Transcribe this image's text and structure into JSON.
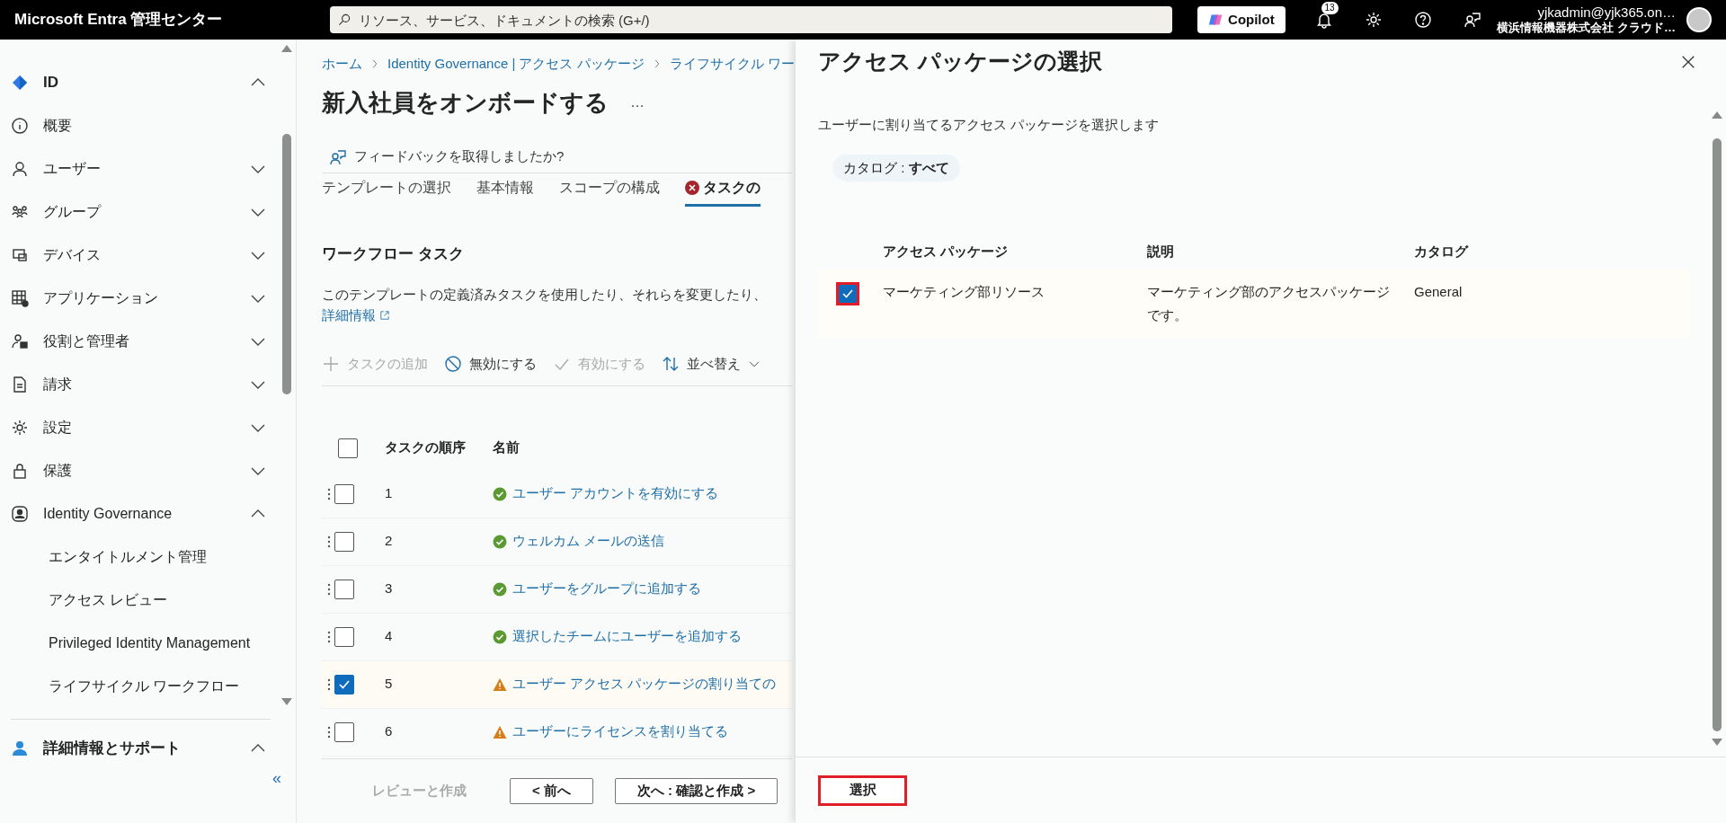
{
  "top_bar": {
    "title": "Microsoft Entra 管理センター",
    "search": {
      "placeholder": "リソース、サービス、ドキュメントの検索 (G+/)"
    },
    "copilot_button": "Copilot",
    "notification_count": "13",
    "user": {
      "account": "yjkadmin@yjk365.on…",
      "organization": "横浜情報機器株式会社 クラウド…"
    }
  },
  "sidebar": {
    "items": [
      {
        "kind": "section",
        "label": "ID",
        "expanded": true
      },
      {
        "kind": "item",
        "label": "概要"
      },
      {
        "kind": "item",
        "label": "ユーザー",
        "expanded": false
      },
      {
        "kind": "item",
        "label": "グループ",
        "expanded": false
      },
      {
        "kind": "item",
        "label": "デバイス",
        "expanded": false
      },
      {
        "kind": "item",
        "label": "アプリケーション",
        "expanded": false
      },
      {
        "kind": "item",
        "label": "役割と管理者",
        "expanded": false
      },
      {
        "kind": "item",
        "label": "請求",
        "expanded": false
      },
      {
        "kind": "item",
        "label": "設定",
        "expanded": false
      },
      {
        "kind": "item",
        "label": "保護",
        "expanded": false
      },
      {
        "kind": "item",
        "label": "Identity Governance",
        "expanded": true
      },
      {
        "kind": "subitem",
        "label": "エンタイトルメント管理"
      },
      {
        "kind": "subitem",
        "label": "アクセス レビュー"
      },
      {
        "kind": "subitem",
        "label": "Privileged Identity Management"
      },
      {
        "kind": "subitem",
        "label": "ライフサイクル ワークフロー"
      }
    ],
    "footer": {
      "label": "詳細情報とサポート",
      "expanded": true
    },
    "collapse_button": "«"
  },
  "main": {
    "breadcrumb": [
      "ホーム",
      "Identity Governance | アクセス パッケージ",
      "ライフサイクル ワー"
    ],
    "title": "新入社員をオンボードする",
    "more_button": "…",
    "feedback": "フィードバックを取得しましたか?",
    "tabs": [
      {
        "label": "テンプレートの選択",
        "selected": false
      },
      {
        "label": "基本情報",
        "selected": false
      },
      {
        "label": "スコープの構成",
        "selected": false
      },
      {
        "label": "タスクの",
        "selected": true,
        "error": true
      }
    ],
    "section_title": "ワークフロー タスク",
    "description": "このテンプレートの定義済みタスクを使用したり、それらを変更したり、",
    "learn_more": "詳細情報",
    "toolbar": [
      {
        "kind": "add",
        "label": "タスクの追加",
        "disabled": true
      },
      {
        "kind": "disable",
        "label": "無効にする",
        "disabled": false
      },
      {
        "kind": "enable",
        "label": "有効にする",
        "disabled": true
      },
      {
        "kind": "sort",
        "label": "並べ替え",
        "disabled": false
      }
    ],
    "table": {
      "columns": [
        "タスクの順序",
        "名前"
      ],
      "all_checked": false,
      "rows": [
        {
          "order": "1",
          "name": "ユーザー アカウントを有効にする",
          "warning": false,
          "checked": false
        },
        {
          "order": "2",
          "name": "ウェルカム メールの送信",
          "warning": false,
          "checked": false
        },
        {
          "order": "3",
          "name": "ユーザーをグループに追加する",
          "warning": false,
          "checked": false
        },
        {
          "order": "4",
          "name": "選択したチームにユーザーを追加する",
          "warning": false,
          "checked": false
        },
        {
          "order": "5",
          "name": "ユーザー アクセス パッケージの割り当ての",
          "warning": true,
          "checked": true
        },
        {
          "order": "6",
          "name": "ユーザーにライセンスを割り当てる",
          "warning": true,
          "checked": false
        }
      ]
    },
    "footer_buttons": [
      {
        "label": "レビューと作成",
        "disabled": true
      },
      {
        "label": "< 前へ",
        "disabled": false
      },
      {
        "label": "次へ : 確認と作成 >",
        "disabled": false
      }
    ]
  },
  "panel": {
    "title": "アクセス パッケージの選択",
    "description": "ユーザーに割り当てるアクセス パッケージを選択します",
    "filter": "カタログ : **すべて**",
    "table": {
      "columns": [
        "アクセス パッケージ",
        "説明",
        "カタログ"
      ],
      "rows": [
        {
          "cells": [
            "マーケティング部リソース",
            "マーケティング部のアクセスパッケージです。",
            "General"
          ],
          "checked": true,
          "highlighted": true
        }
      ]
    },
    "select_button": {
      "label": "選択",
      "highlighted": true
    }
  }
}
